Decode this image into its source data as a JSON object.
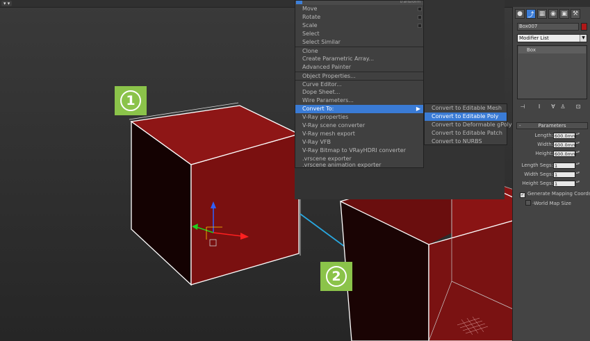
{
  "viewport": {
    "label": "▾ ▾"
  },
  "steps": {
    "one": "1",
    "two": "2"
  },
  "quad_menu": {
    "header": "transform",
    "items": [
      {
        "label": "Move"
      },
      {
        "label": "Rotate"
      },
      {
        "label": "Scale"
      },
      {
        "label": "Select"
      },
      {
        "label": "Select Similar"
      },
      {
        "label": "Clone"
      },
      {
        "label": "Create Parametric Array..."
      },
      {
        "label": "Advanced Painter"
      },
      {
        "label": "Object Properties..."
      },
      {
        "label": "Curve Editor..."
      },
      {
        "label": "Dope Sheet..."
      },
      {
        "label": "Wire Parameters..."
      },
      {
        "label": "Convert To:"
      },
      {
        "label": "V-Ray properties"
      },
      {
        "label": "V-Ray scene converter"
      },
      {
        "label": "V-Ray mesh export"
      },
      {
        "label": "V-Ray VFB"
      },
      {
        "label": "V-Ray Bitmap to VRayHDRI converter"
      },
      {
        "label": ".vrscene exporter"
      },
      {
        "label": ".vrscene animation exporter"
      }
    ],
    "submenu_arrow": "▶"
  },
  "convert_submenu": {
    "items": [
      {
        "label": "Convert to Editable Mesh"
      },
      {
        "label": "Convert to Editable Poly"
      },
      {
        "label": "Convert to Deformable gPoly"
      },
      {
        "label": "Convert to Editable Patch"
      },
      {
        "label": "Convert to NURBS"
      }
    ]
  },
  "command_panel": {
    "tabs": [
      {
        "icon": "●"
      },
      {
        "icon": "⤴"
      },
      {
        "icon": "▦"
      },
      {
        "icon": "◉"
      },
      {
        "icon": "▣"
      },
      {
        "icon": "⚒"
      }
    ],
    "object_name": "Box007",
    "object_color": "#b01818",
    "modifier_list": "Modifier List",
    "modifier_dd_icon": "▼",
    "stack_item": "Box",
    "stack_tools": [
      "⊣",
      "I",
      "∀",
      "♙",
      "⊡"
    ],
    "rollout_title": "Parameters",
    "rollout_minus": "-",
    "params": [
      {
        "label": "Length:",
        "value": "600.0mm"
      },
      {
        "label": "Width:",
        "value": "600.0mm"
      },
      {
        "label": "Height:",
        "value": "600.0mm"
      },
      {
        "label": "Length Segs:",
        "value": "1"
      },
      {
        "label": "Width Segs:",
        "value": "1"
      },
      {
        "label": "Height Segs:",
        "value": "1"
      }
    ],
    "spinner": "▴▾",
    "gen_mapping": "Generate Mapping Coords.",
    "gen_mapping_check": "✓",
    "real_world": "-World Map Size"
  },
  "colors": {
    "highlight": "#3a7bd5",
    "box_red": "#8a1414",
    "box_dark": "#1a0404"
  }
}
